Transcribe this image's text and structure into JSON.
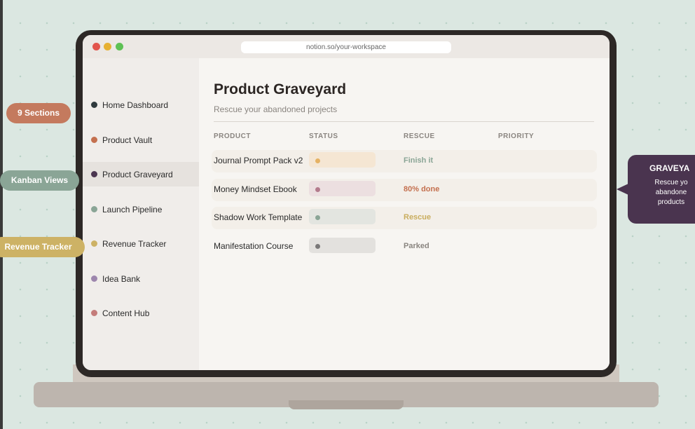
{
  "browser": {
    "url": "notion.so/your-workspace"
  },
  "sidebar": {
    "items": [
      {
        "label": "Home Dashboard",
        "color": "#2f3a3d"
      },
      {
        "label": "Product Vault",
        "color": "#c4704f"
      },
      {
        "label": "Product Graveyard",
        "color": "#4b3650",
        "active": true
      },
      {
        "label": "Launch Pipeline",
        "color": "#8aa596"
      },
      {
        "label": "Revenue Tracker",
        "color": "#cdb265"
      },
      {
        "label": "Idea Bank",
        "color": "#9d86ad"
      },
      {
        "label": "Content Hub",
        "color": "#c47c7a"
      }
    ]
  },
  "page": {
    "title": "Product Graveyard",
    "subtitle": "Rescue your abandoned projects"
  },
  "table": {
    "columns": [
      "PRODUCT",
      "STATUS",
      "RESCUE",
      "PRIORITY"
    ],
    "rows": [
      {
        "product": "Journal Prompt Pack v2",
        "status_color": "#e5b264",
        "status_bg": "#f5e6d3",
        "rescue": "Finish it",
        "rescue_color": "#8aa596"
      },
      {
        "product": "Money Mindset Ebook",
        "status_color": "#b37b8c",
        "status_bg": "#ecdfe0",
        "rescue": "80% done",
        "rescue_color": "#c4704f"
      },
      {
        "product": "Shadow Work Template",
        "status_color": "#8aa596",
        "status_bg": "#e3e5e0",
        "rescue": "Rescue",
        "rescue_color": "#c9ad5e"
      },
      {
        "product": "Manifestation Course",
        "status_color": "#7a7878",
        "status_bg": "#e3e1de",
        "rescue": "Parked",
        "rescue_color": "#8a8580"
      }
    ]
  },
  "annotations": {
    "sections": "9 Sections",
    "kanban": "Kanban Views",
    "revenue": "Revenue Tracker"
  },
  "callout": {
    "title": "GRAVEYA",
    "lines": [
      "Rescue yo",
      "abandone",
      "products"
    ]
  },
  "colors": {
    "background": "#dbe7e1",
    "bezel": "#2d2826",
    "callout": "#4a344f"
  }
}
